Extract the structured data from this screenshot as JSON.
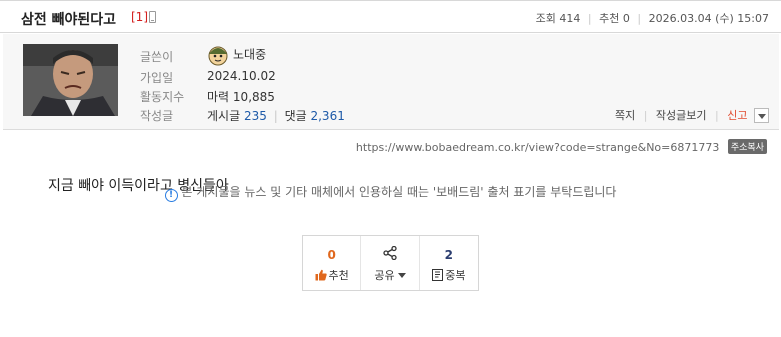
{
  "post": {
    "title": "삼전 빼야된다고",
    "comment_count": "[1]",
    "body": "지금 빼야 이득이라고 병신들아"
  },
  "meta": {
    "views_label": "조회",
    "views": "414",
    "recommend_label": "추천",
    "recommend": "0",
    "datetime": "2026.03.04 (수) 15:07"
  },
  "profile": {
    "author_label": "글쓴이",
    "author": "노대중",
    "joined_label": "가입일",
    "joined": "2024.10.02",
    "activity_label": "활동지수",
    "activity_prefix": "마력",
    "activity_value": "10,885",
    "posts_label": "작성글",
    "posts_prefix": "게시글",
    "posts_count": "235",
    "comments_prefix": "댓글",
    "comments_count": "2,361"
  },
  "actions": {
    "note": "쪽지",
    "view_posts": "작성글보기",
    "report": "신고"
  },
  "url": {
    "text": "https://www.bobaedream.co.kr/view?code=strange&No=6871773",
    "copy_label": "주소복사"
  },
  "vote": {
    "recommend_count": "0",
    "recommend_label": "추천",
    "share_label": "공유",
    "scrap_count": "2",
    "scrap_label": "중복"
  },
  "notice": {
    "text": "본 게시물을 뉴스 및 기타 매체에서 인용하실 때는 '보배드림' 출처 표기를 부탁드립니다"
  },
  "colors": {
    "accent_red": "#d4201f",
    "link_blue": "#1e5aa8",
    "recommend_orange": "#e0681e",
    "info_blue": "#2a7de1"
  },
  "icons": [
    "mobile-icon",
    "avatar-icon",
    "dropdown-icon",
    "thumbs-up-icon",
    "share-icon",
    "scrap-icon",
    "info-icon"
  ]
}
